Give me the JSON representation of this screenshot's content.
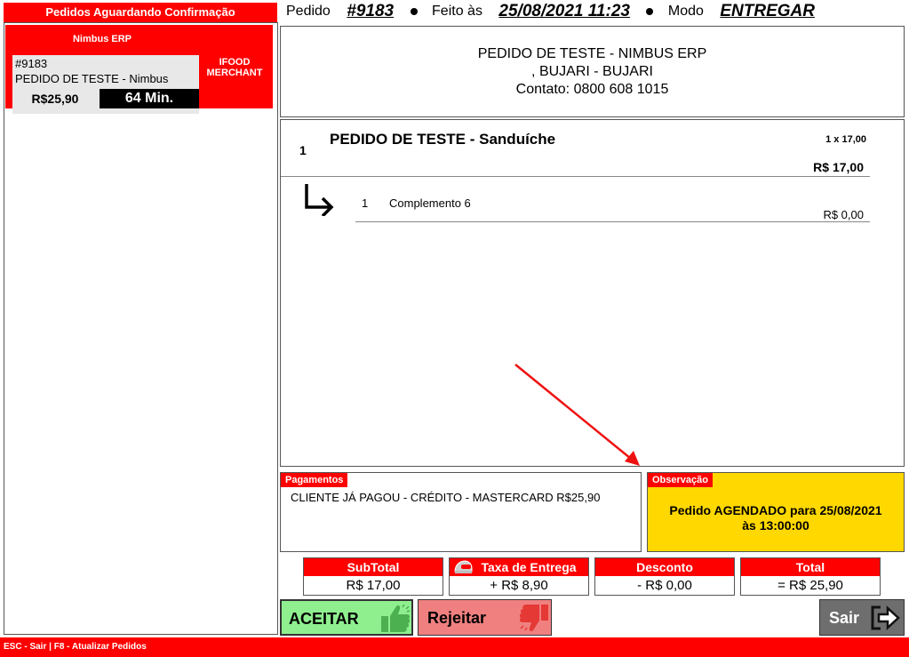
{
  "left_panel": {
    "title": "Pedidos Aguardando Confirmação",
    "orders": [
      {
        "source": "Nimbus ERP",
        "number": "#9183",
        "description": "PEDIDO DE TESTE - Nimbus",
        "price": "R$25,90",
        "elapsed": "64 Min.",
        "merchant_line1": "IFOOD",
        "merchant_line2": "MERCHANT"
      }
    ]
  },
  "header": {
    "order_label": "Pedido",
    "order_number": "#9183",
    "made_label": "Feito às",
    "made_datetime": "25/08/2021 11:23",
    "mode_label": "Modo",
    "mode_value": "ENTREGAR"
  },
  "store": {
    "line1": "PEDIDO DE TESTE - NIMBUS ERP",
    "line2": ", BUJARI - BUJARI",
    "line3": "Contato: 0800 608 1015"
  },
  "items": [
    {
      "qty": "1",
      "name": "PEDIDO DE TESTE - Sanduíche",
      "unit": "1 x 17,00",
      "total": "R$ 17,00",
      "complements": [
        {
          "qty": "1",
          "name": "Complemento 6",
          "price": "R$ 0,00"
        }
      ]
    }
  ],
  "payments": {
    "tag": "Pagamentos",
    "text": "CLIENTE JÁ PAGOU - CRÉDITO - MASTERCARD R$25,90"
  },
  "observation": {
    "tag": "Observação",
    "line1": "Pedido AGENDADO para 25/08/2021",
    "line2": "às 13:00:00"
  },
  "totals": {
    "subtotal_label": "SubTotal",
    "subtotal_value": "R$ 17,00",
    "fee_label": "Taxa de Entrega",
    "fee_value": "+ R$ 8,90",
    "discount_label": "Desconto",
    "discount_value": "- R$ 0,00",
    "total_label": "Total",
    "total_value": "= R$ 25,90"
  },
  "buttons": {
    "accept": "ACEITAR",
    "reject": "Rejeitar",
    "exit": "Sair"
  },
  "footer": {
    "text": "ESC - Sair  | F8 - Atualizar Pedidos"
  },
  "icons": {
    "accept": "thumbs-up-icon",
    "reject": "thumbs-down-icon",
    "exit": "exit-arrow-icon",
    "fee": "helmet-icon",
    "complement": "sub-item-arrow-icon"
  },
  "colors": {
    "brand_red": "#ff0000",
    "observation_yellow": "#ffd800",
    "accept_green": "#8fef8f",
    "accept_icon_green": "#4caf50",
    "reject_red": "#f08080",
    "reject_icon_red": "#e53935",
    "exit_gray": "#6e6e6e"
  }
}
